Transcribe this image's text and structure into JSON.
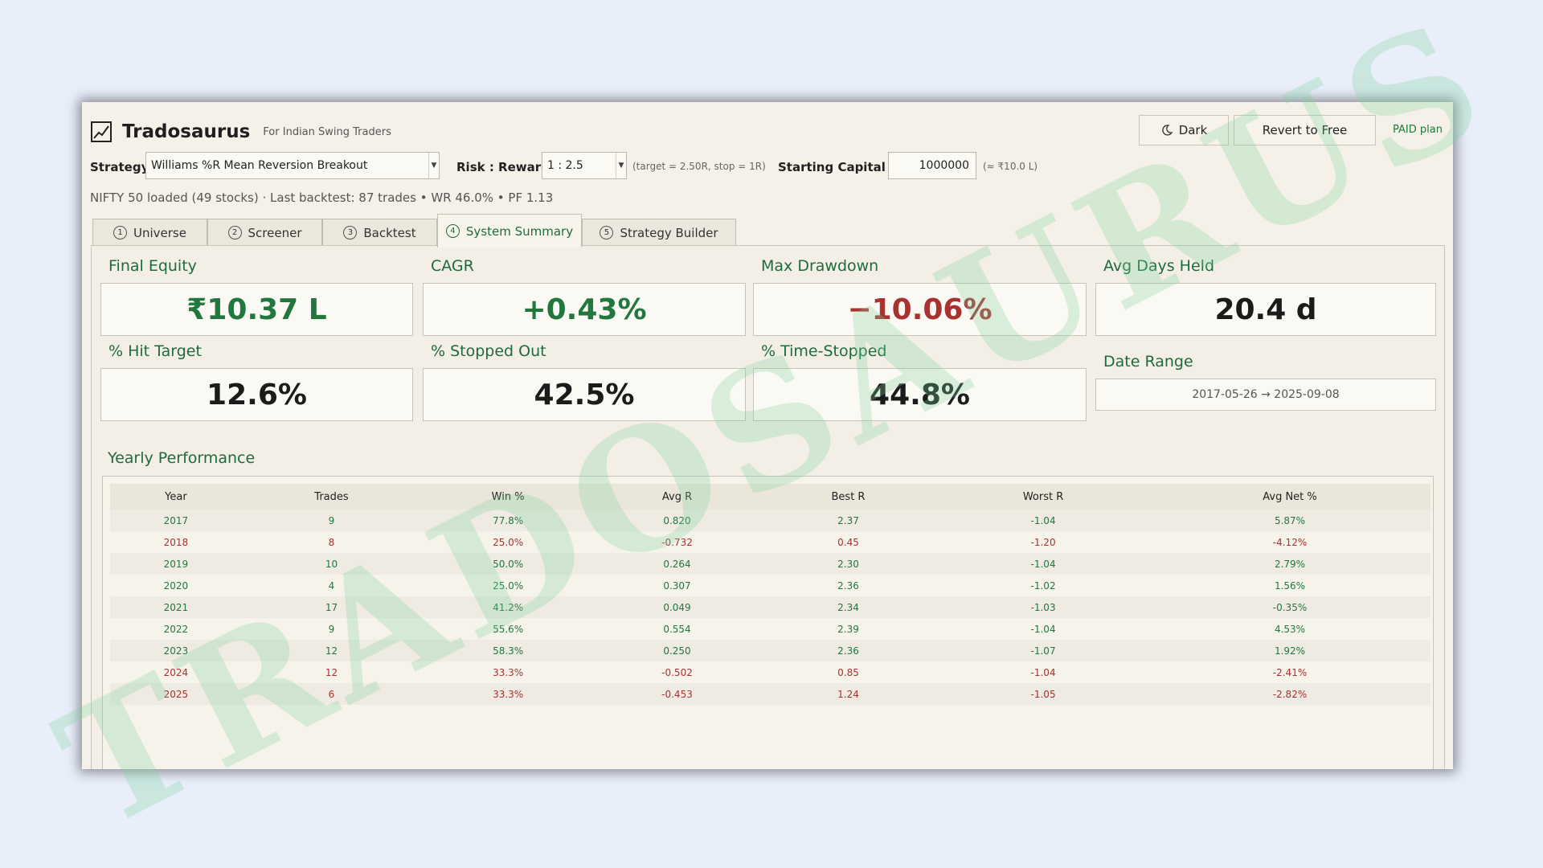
{
  "app": {
    "title": "Tradosaurus",
    "subtitle": "For Indian Swing Traders",
    "watermark": "TRADOSAURUS"
  },
  "header": {
    "dark_label": "Dark",
    "revert_label": "Revert to Free",
    "plan_label": "PAID plan"
  },
  "controls": {
    "strategy_label": "Strategy",
    "strategy_value": "Williams %R Mean Reversion Breakout",
    "risk_label": "Risk : Reward",
    "risk_value": "1 : 2.5",
    "risk_hint": "(target = 2.50R, stop = 1R)",
    "capital_label": "Starting Capital ₹",
    "capital_value": "1000000",
    "capital_hint": "(≈ ₹10.0 L)"
  },
  "status": "NIFTY 50 loaded (49 stocks) · Last backtest: 87 trades • WR 46.0% • PF 1.13",
  "tabs": [
    {
      "num": "1",
      "label": "Universe"
    },
    {
      "num": "2",
      "label": "Screener"
    },
    {
      "num": "3",
      "label": "Backtest"
    },
    {
      "num": "4",
      "label": "System Summary"
    },
    {
      "num": "5",
      "label": "Strategy Builder"
    }
  ],
  "metrics": {
    "final_equity": {
      "label": "Final Equity",
      "value": "₹10.37 L"
    },
    "cagr": {
      "label": "CAGR",
      "value": "+0.43%"
    },
    "max_drawdown": {
      "label": "Max Drawdown",
      "value": "−10.06%"
    },
    "avg_days": {
      "label": "Avg Days Held",
      "value": "20.4 d"
    },
    "hit_target": {
      "label": "% Hit Target",
      "value": "12.6%"
    },
    "stopped_out": {
      "label": "% Stopped Out",
      "value": "42.5%"
    },
    "time_stopped": {
      "label": "% Time-Stopped",
      "value": "44.8%"
    },
    "date_range": {
      "label": "Date Range",
      "value": "2017-05-26 → 2025-09-08"
    }
  },
  "yearly": {
    "title": "Yearly Performance",
    "columns": [
      "Year",
      "Trades",
      "Win %",
      "Avg R",
      "Best R",
      "Worst R",
      "Avg Net %"
    ],
    "rows": [
      [
        "2017",
        "9",
        "77.8%",
        "0.820",
        "2.37",
        "-1.04",
        "5.87%"
      ],
      [
        "2018",
        "8",
        "25.0%",
        "-0.732",
        "0.45",
        "-1.20",
        "-4.12%"
      ],
      [
        "2019",
        "10",
        "50.0%",
        "0.264",
        "2.30",
        "-1.04",
        "2.79%"
      ],
      [
        "2020",
        "4",
        "25.0%",
        "0.307",
        "2.36",
        "-1.02",
        "1.56%"
      ],
      [
        "2021",
        "17",
        "41.2%",
        "0.049",
        "2.34",
        "-1.03",
        "-0.35%"
      ],
      [
        "2022",
        "9",
        "55.6%",
        "0.554",
        "2.39",
        "-1.04",
        "4.53%"
      ],
      [
        "2023",
        "12",
        "58.3%",
        "0.250",
        "2.36",
        "-1.07",
        "1.92%"
      ],
      [
        "2024",
        "12",
        "33.3%",
        "-0.502",
        "0.85",
        "-1.04",
        "-2.41%"
      ],
      [
        "2025",
        "6",
        "33.3%",
        "-0.453",
        "1.24",
        "-1.05",
        "-2.82%"
      ]
    ]
  },
  "colors": {
    "positive": "#22773f",
    "negative": "#a83232",
    "accent": "#1e6b3c"
  }
}
